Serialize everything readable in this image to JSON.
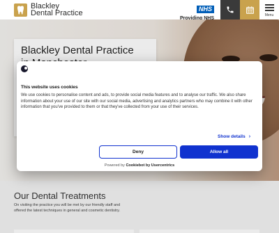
{
  "header": {
    "logo_line1": "Blackley",
    "logo_line2": "Dental Practice",
    "nhs_badge": "NHS",
    "nhs_text": "Providing NHS services",
    "phone_icon": "phone-icon",
    "calendar_icon": "calendar-icon",
    "menu_label": "Menu"
  },
  "hero": {
    "title_line1": "Blackley Dental Practice",
    "title_line2": "in Manchester"
  },
  "cookie": {
    "title": "This website uses cookies",
    "body": "We use cookies to personalise content and ads, to provide social media features and to analyse our traffic. We also share information about your use of our site with our social media, advertising and analytics partners who may combine it with other information that you've provided to them or that they've collected from your use of their services.",
    "details_label": "Show details",
    "deny_label": "Deny",
    "allow_label": "Allow all",
    "powered_prefix": "Powered by",
    "powered_brand": "Cookiebot by Usercentrics"
  },
  "treatments": {
    "title": "Our Dental Treatments",
    "text": "On visiting the practice you will be met by our friendly staff and offered the latest techniques in general and cosmetic dentistry."
  },
  "colors": {
    "gold": "#c9a24d",
    "nhs_blue": "#005eb8",
    "cookiebot_blue": "#1032cf",
    "dark": "#3a3a3a"
  }
}
